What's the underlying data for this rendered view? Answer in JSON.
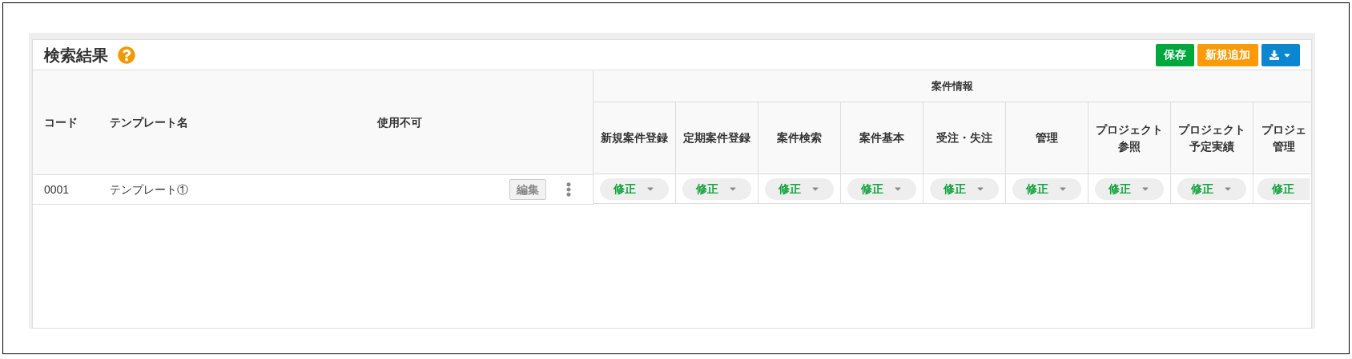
{
  "title": "検索結果",
  "buttons": [
    {
      "kind": "save",
      "label": "保存"
    },
    {
      "kind": "add",
      "label": "新規追加"
    },
    {
      "kind": "download"
    }
  ],
  "table": {
    "columns": [
      "コード",
      "テンプレート名",
      "使用不可"
    ],
    "group_header": "案件情報",
    "permission_columns": [
      {
        "lines": [
          "新規案件登録"
        ],
        "partial": false
      },
      {
        "lines": [
          "定期案件登録"
        ],
        "partial": false
      },
      {
        "lines": [
          "案件検索"
        ],
        "partial": false
      },
      {
        "lines": [
          "案件基本"
        ],
        "partial": false
      },
      {
        "lines": [
          "受注・失注"
        ],
        "partial": false
      },
      {
        "lines": [
          "管理"
        ],
        "partial": false
      },
      {
        "lines": [
          "プロジェクト",
          "参照"
        ],
        "partial": false
      },
      {
        "lines": [
          "プロジェクト",
          "予定実績"
        ],
        "partial": false
      },
      {
        "lines": [
          "プロジェ",
          "管理"
        ],
        "partial": true
      }
    ],
    "rows": [
      {
        "code": "0001",
        "name": "テンプレート①",
        "edit": "編集",
        "permissions": [
          "修正",
          "修正",
          "修正",
          "修正",
          "修正",
          "修正",
          "修正",
          "修正",
          "修正"
        ]
      }
    ]
  }
}
